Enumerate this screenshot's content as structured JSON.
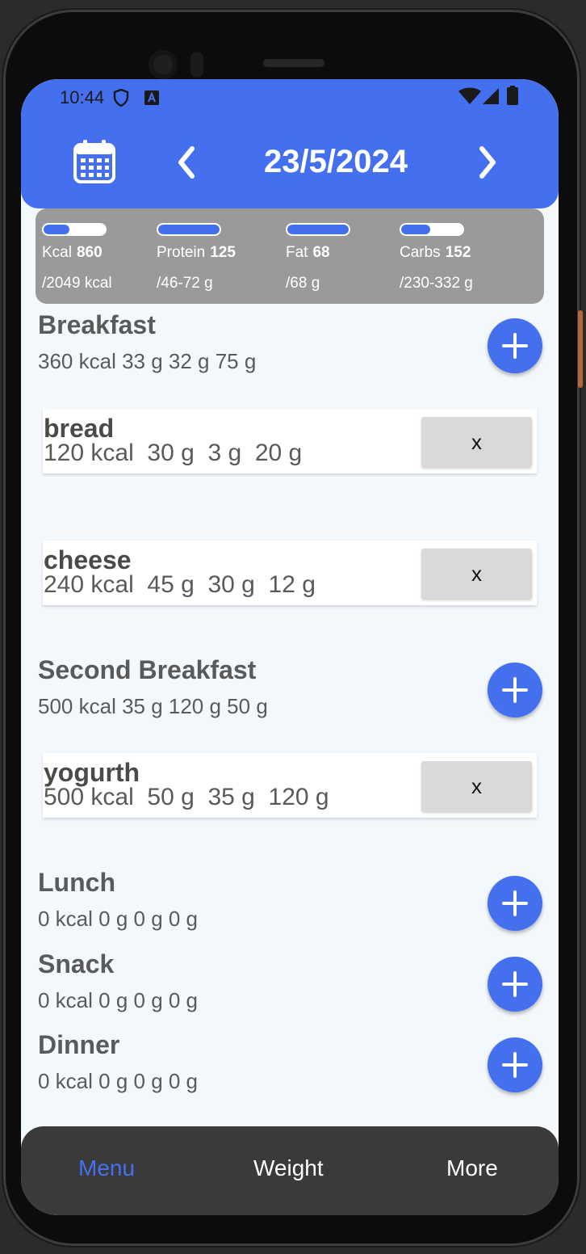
{
  "status_bar": {
    "time": "10:44"
  },
  "header": {
    "date": "23/5/2024"
  },
  "macros": [
    {
      "name": "Kcal",
      "value": "860",
      "goal": "/2049 kcal",
      "progress": 0.42
    },
    {
      "name": "Protein",
      "value": "125",
      "goal": "/46-72 g",
      "progress": 1.0
    },
    {
      "name": "Fat",
      "value": "68",
      "goal": "/68 g",
      "progress": 1.0
    },
    {
      "name": "Carbs",
      "value": "152",
      "goal": "/230-332 g",
      "progress": 0.48
    }
  ],
  "meals": [
    {
      "title": "Breakfast",
      "summary": "360 kcal 33 g 32 g 75 g",
      "foods": [
        {
          "name": "bread",
          "values": "120 kcal  30 g  3 g  20 g",
          "delete_label": "x"
        },
        {
          "name": "cheese",
          "values": "240 kcal  45 g  30 g  12 g",
          "delete_label": "x"
        }
      ]
    },
    {
      "title": "Second Breakfast",
      "summary": "500 kcal 35 g 120 g 50 g",
      "foods": [
        {
          "name": "yogurth",
          "values": "500 kcal  50 g  35 g  120 g",
          "delete_label": "x"
        }
      ]
    },
    {
      "title": "Lunch",
      "summary": "0 kcal 0 g 0 g 0 g",
      "foods": []
    },
    {
      "title": "Snack",
      "summary": "0 kcal 0 g 0 g 0 g",
      "foods": []
    },
    {
      "title": "Dinner",
      "summary": "0 kcal 0 g 0 g 0 g",
      "foods": []
    }
  ],
  "nav": {
    "active_color": "#4470ef",
    "items": [
      "Menu",
      "Weight",
      "More"
    ],
    "active": "Menu"
  },
  "colors": {
    "accent": "#4470ef",
    "summary_card": "#9a9a9a",
    "background": "#f3f8fd"
  },
  "icons": [
    "calendar-icon",
    "chevron-left-icon",
    "chevron-right-icon",
    "plus-icon",
    "wifi-icon",
    "signal-icon",
    "battery-icon",
    "shield-icon"
  ]
}
